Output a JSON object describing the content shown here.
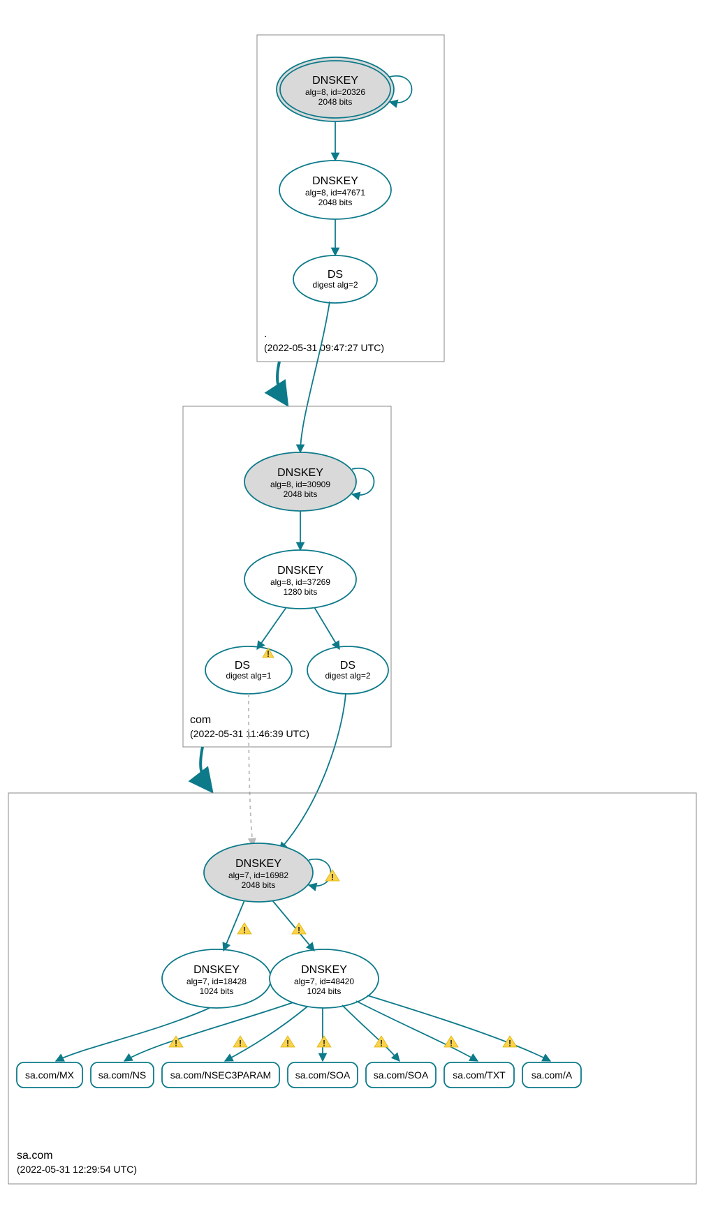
{
  "diagram": {
    "zones": [
      {
        "name": ".",
        "timestamp": "(2022-05-31 09:47:27 UTC)",
        "nodes": [
          {
            "id": "root-ksk",
            "title": "DNSKEY",
            "line2": "alg=8, id=20326",
            "line3": "2048 bits"
          },
          {
            "id": "root-zsk",
            "title": "DNSKEY",
            "line2": "alg=8, id=47671",
            "line3": "2048 bits"
          },
          {
            "id": "root-ds",
            "title": "DS",
            "line2": "digest alg=2",
            "line3": ""
          }
        ]
      },
      {
        "name": "com",
        "timestamp": "(2022-05-31 11:46:39 UTC)",
        "nodes": [
          {
            "id": "com-ksk",
            "title": "DNSKEY",
            "line2": "alg=8, id=30909",
            "line3": "2048 bits"
          },
          {
            "id": "com-zsk",
            "title": "DNSKEY",
            "line2": "alg=8, id=37269",
            "line3": "1280 bits"
          },
          {
            "id": "com-ds1",
            "title": "DS",
            "line2": "digest alg=1",
            "line3": "",
            "warn": true
          },
          {
            "id": "com-ds2",
            "title": "DS",
            "line2": "digest alg=2",
            "line3": ""
          }
        ]
      },
      {
        "name": "sa.com",
        "timestamp": "(2022-05-31 12:29:54 UTC)",
        "nodes": [
          {
            "id": "sa-ksk",
            "title": "DNSKEY",
            "line2": "alg=7, id=16982",
            "line3": "2048 bits",
            "warn": true
          },
          {
            "id": "sa-zsk1",
            "title": "DNSKEY",
            "line2": "alg=7, id=18428",
            "line3": "1024 bits"
          },
          {
            "id": "sa-zsk2",
            "title": "DNSKEY",
            "line2": "alg=7, id=48420",
            "line3": "1024 bits"
          }
        ],
        "rrsets": [
          {
            "label": "sa.com/MX"
          },
          {
            "label": "sa.com/NS"
          },
          {
            "label": "sa.com/NSEC3PARAM"
          },
          {
            "label": "sa.com/SOA"
          },
          {
            "label": "sa.com/SOA"
          },
          {
            "label": "sa.com/TXT"
          },
          {
            "label": "sa.com/A"
          }
        ]
      }
    ]
  }
}
